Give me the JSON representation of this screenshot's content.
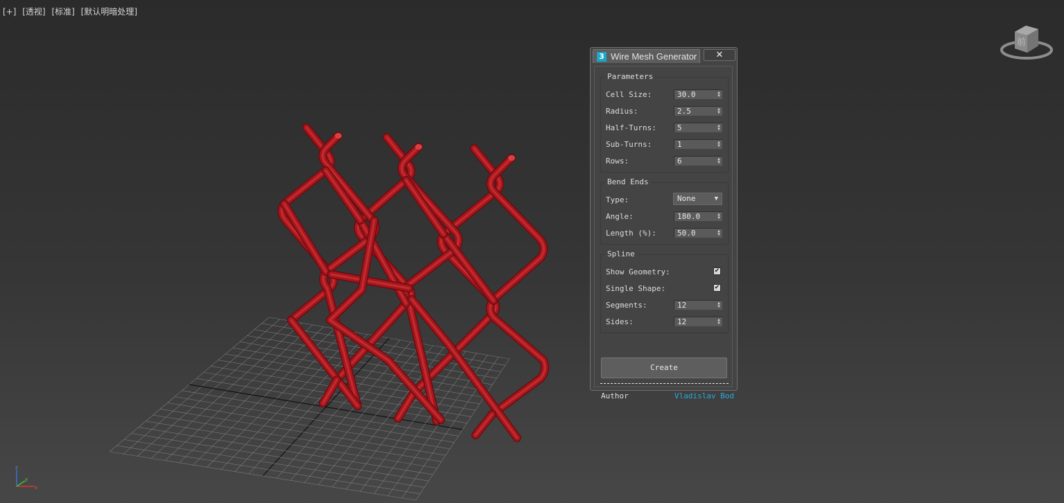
{
  "viewport": {
    "labels": [
      "[+]",
      "[透视]",
      "[标准]",
      "[默认明暗处理]"
    ],
    "viewcube_face": "前",
    "axis": {
      "x": "x",
      "y": "y",
      "z": "z"
    }
  },
  "dialog": {
    "icon_text": "3",
    "title": "Wire Mesh Generator",
    "close_symbol": "✕",
    "parameters": {
      "title": "Parameters",
      "cell_size": {
        "label": "Cell Size:",
        "value": "30.0"
      },
      "radius": {
        "label": "Radius:",
        "value": "2.5"
      },
      "half_turns": {
        "label": "Half-Turns:",
        "value": "5"
      },
      "sub_turns": {
        "label": "Sub-Turns:",
        "value": "1"
      },
      "rows": {
        "label": "Rows:",
        "value": "6"
      }
    },
    "bend_ends": {
      "title": "Bend Ends",
      "type": {
        "label": "Type:",
        "value": "None"
      },
      "angle": {
        "label": "Angle:",
        "value": "180.0"
      },
      "length": {
        "label": "Length (%):",
        "value": "50.0"
      }
    },
    "spline": {
      "title": "Spline",
      "show_geometry": {
        "label": "Show Geometry:",
        "checked": true
      },
      "single_shape": {
        "label": "Single Shape:",
        "checked": true
      },
      "segments": {
        "label": "Segments:",
        "value": "12"
      },
      "sides": {
        "label": "Sides:",
        "value": "12"
      }
    },
    "create_label": "Create",
    "separator": "--------------------------------",
    "author_label": "Author",
    "author_name": "Vladislav Bod"
  },
  "colors": {
    "wire": "#a6161c",
    "wire_highlight": "#d94044",
    "wire_shadow": "#6a0c10",
    "link": "#28a9dc",
    "grid": "#8a8a8a"
  }
}
